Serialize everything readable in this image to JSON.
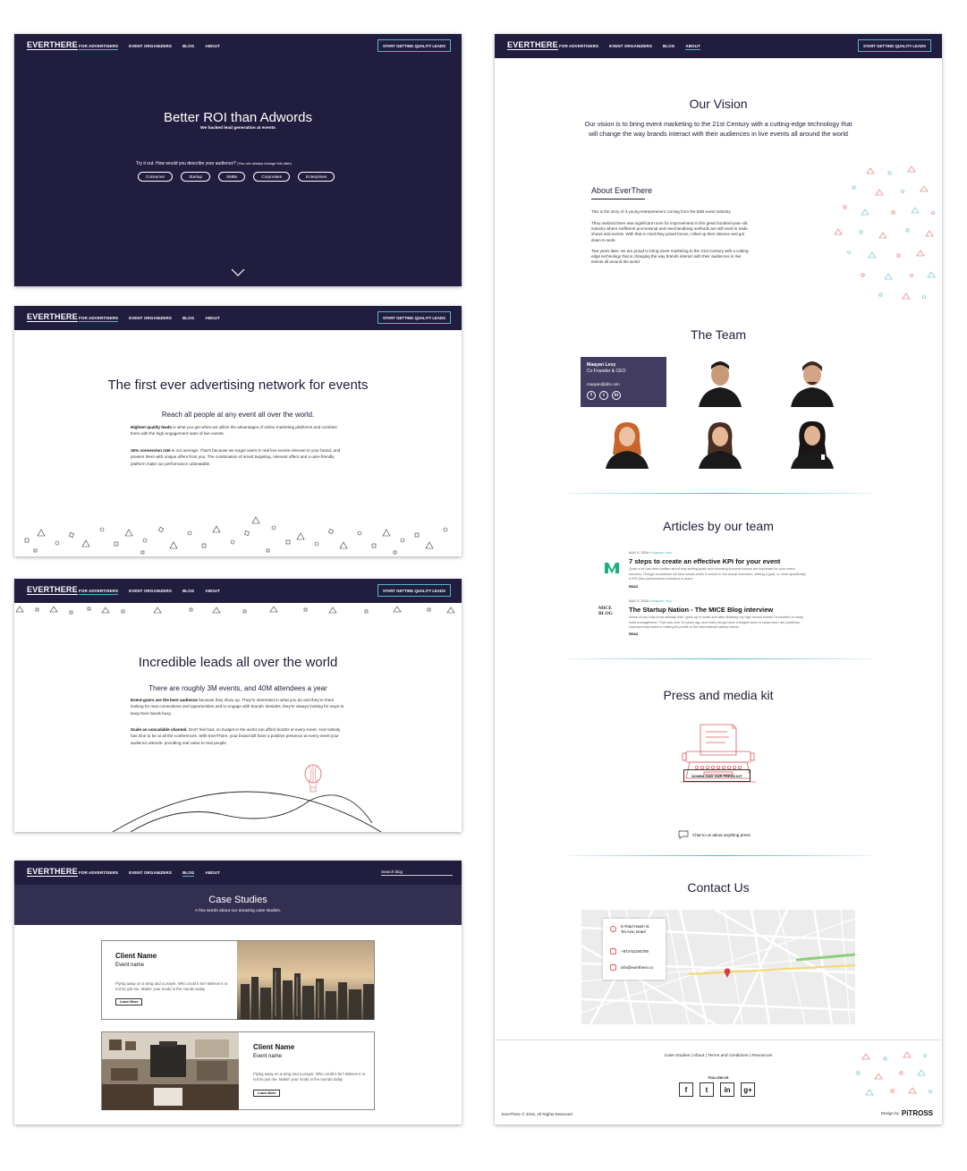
{
  "brand": {
    "logo": "EVERTHERE",
    "accent_color": "#4fb7c9",
    "nav_bg": "#211d3f",
    "red_accent": "#e05b5b"
  },
  "nav": {
    "items": [
      "FOR ADVERTISERS",
      "EVENT ORGANIZERS",
      "BLOG",
      "ABOUT"
    ],
    "cta": "START GETTING QUALITY LEADS",
    "search_placeholder": "Search blog"
  },
  "hero": {
    "title": "Better ROI than Adwords",
    "subtitle": "We hacked lead generation at events",
    "question": "Try it out. How would you describe your audience?",
    "question_note": "(You can always change this later)",
    "audiences": [
      "Consumer",
      "Startup",
      "SMBs",
      "Corporates",
      "Enterprises"
    ]
  },
  "network": {
    "title": "The first ever advertising network for events",
    "subtitle": "Reach all people at any event all over the world.",
    "p1_bold": "Highest quality leads",
    "p1": " is what you get when we utilize the advantages of online marketing platforms and combine them with the high engagement rates of live events.",
    "p2_bold": "15% conversion rate",
    "p2": " is our average. That's because we target users in real live events relevant to your brand, and present them with unique offers from you. The combination of smart targeting, relevant offers and a user-friendly platform make our performance unbeatable."
  },
  "leads": {
    "title": "Incredible leads all over the world",
    "subtitle": "There are roughly 3M events, and 40M attendees a year",
    "p1_bold": "Event-goers are the best audience",
    "p1": " because they show up. They're interested in what you do and they're there looking for new connections and opportunities and to engage with brands. Besides, they're always looking for ways to keep their hands busy.",
    "p2_bold": "Scale an unscalable channel.",
    "p2": " Don't feel bad, no budget in the world can afford booths at every event. And nobody has time to be at all the conferences. With EverThere, your brand will have a positive presence at every event your audience attends- providing real value to real people."
  },
  "case_studies": {
    "title": "Case Studies",
    "subtitle": "A few words about our amazing case studies.",
    "cards": [
      {
        "client": "Client Name",
        "event": "Event name",
        "desc": "Flying away on a wing and a prayer. Who could it be? Believe it or not its just me. Makin' your mods in the mundo today",
        "more": "Learn More"
      },
      {
        "client": "Client Name",
        "event": "Event name",
        "desc": "Flying away on a wing and a prayer. Who could it be? Believe it or not its just me. Makin' your mods in the mundo today",
        "more": "Learn More"
      }
    ]
  },
  "about_page": {
    "vision_title": "Our Vision",
    "vision_text": "Our vision is to bring event marketing to the 21st Century with a cutting-edge technology that will change the way brands interact with their audiences in live events all around the world",
    "about_title": "About EverThere",
    "about_p1": "This is the story of 3 young entrepreneurs coming from the B2B event industry.",
    "about_p2": "They realized there was significant room for improvement in this great hundred-year-old industry where inefficient promotional and merchandising methods are still used in trade shows and events. With that in mind they joined forces, rolled up their sleeves and got down to work.",
    "about_p3": "Two years later, we are proud to bring event marketing to the 21st Century with a cutting-edge technology that is changing the way brands interact with their audiences in live events all around the world.",
    "team_title": "The Team",
    "team_member": {
      "name": "Maayan Levy",
      "role": "Co Founder & CEO",
      "email": "maayan@dim.com"
    },
    "articles_title": "Articles by our team",
    "articles": [
      {
        "date": "AUG 9, 2016",
        "author": "Maayan Levy",
        "title": "7 steps to create an effective KPI for your event",
        "desc": "Quite a lot has been written about why setting goals and choosing success factors are important for your event success. Though sometimes we face issues when it comes to the actual execution: setting a goal, or more specifically a KPI (Key performance indicator) in place.",
        "read": "READ",
        "source_icon": "medium-logo-icon"
      },
      {
        "date": "AUG 9, 2016",
        "author": "Maayan Levy",
        "title": "The Startup Nation - The MICE Blog interview",
        "desc": "Some of you may know already that I grew up in Israel and after finishing my high school exams I'd traveled to study hotel management. That was over 10 years ago and many things have changed since in Israel and I am positively surprised that Israel is making its profile in the international startup scene.",
        "read": "READ",
        "source_icon": "mice-blog-logo-icon",
        "source_label": "MICE BLOG"
      }
    ],
    "press_title": "Press and media kit",
    "press_button": "DOWNLOAD OUR PRESS KIT",
    "press_chat": "Chat to us about anything press",
    "contact_title": "Contact Us",
    "contact_address": [
      "9 Ahad Haam st.",
      "Tel Aviv, Israel"
    ],
    "contact_phone": "+972-52345789",
    "contact_email": "info@everthere.co",
    "footer_links": "Case Studies | About | Terms and conditions | Resources",
    "follow_us": "FOLLOW US",
    "social": [
      "f",
      "t",
      "in",
      "g+"
    ],
    "copyright": "EverThere © 2016, All Rights Reserved",
    "design_by_label": "Design by",
    "design_by_name": "PiTROSS"
  }
}
